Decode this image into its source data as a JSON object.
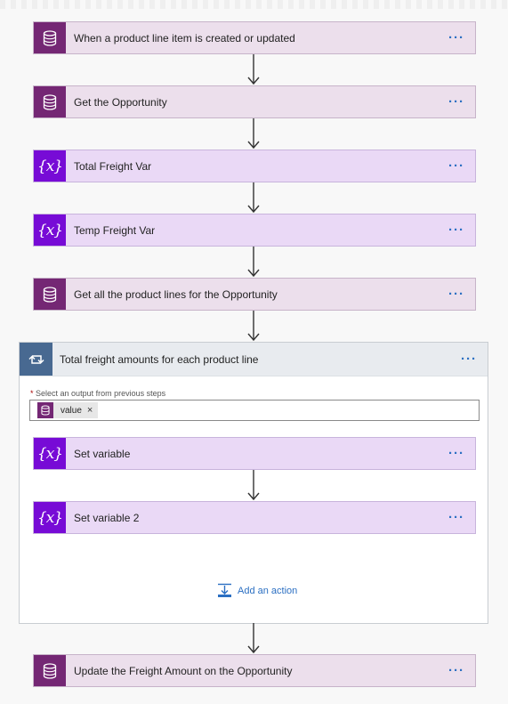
{
  "steps": [
    {
      "label": "When a product line item is created or updated",
      "kind": "dataverse",
      "icon": "database-icon"
    },
    {
      "label": "Get the Opportunity",
      "kind": "dataverse",
      "icon": "database-icon"
    },
    {
      "label": "Total Freight Var",
      "kind": "variable",
      "icon": "variable-icon"
    },
    {
      "label": "Temp Freight Var",
      "kind": "variable",
      "icon": "variable-icon"
    },
    {
      "label": "Get all the product lines for the Opportunity",
      "kind": "dataverse",
      "icon": "database-icon"
    }
  ],
  "loop": {
    "title": "Total freight amounts for each product line",
    "icon": "loop-icon",
    "required_marker": "*",
    "output_label": "Select an output from previous steps",
    "token": {
      "label": "value",
      "remove": "×",
      "icon": "database-icon"
    },
    "inner_steps": [
      {
        "label": "Set variable",
        "kind": "variable",
        "icon": "variable-icon"
      },
      {
        "label": "Set variable 2",
        "kind": "variable",
        "icon": "variable-icon"
      }
    ],
    "add_action_label": "Add an action"
  },
  "final_step": {
    "label": "Update the Freight Amount on the Opportunity",
    "kind": "dataverse",
    "icon": "database-icon"
  },
  "more_label": "···",
  "variable_glyph": "{x}",
  "colors": {
    "dataverse_accent": "#742774",
    "variable_accent": "#770bd6",
    "loop_accent": "#486991",
    "link": "#2b6fc2"
  }
}
